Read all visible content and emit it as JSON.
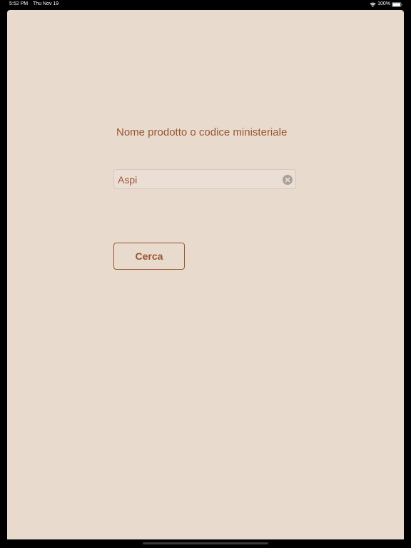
{
  "status_bar": {
    "time": "5:52 PM",
    "date": "Thu Nov 19",
    "battery_percent": "100%",
    "wifi_icon": "wifi-icon",
    "battery_icon": "battery-full-icon",
    "text_color": "#ffffff"
  },
  "form": {
    "label": "Nome prodotto o codice ministeriale",
    "search_value": "Aspi",
    "clear_icon": "clear-circle-icon",
    "search_button_label": "Cerca"
  },
  "colors": {
    "background": "#e9dace",
    "accent": "#97552f",
    "frame": "#000000"
  }
}
